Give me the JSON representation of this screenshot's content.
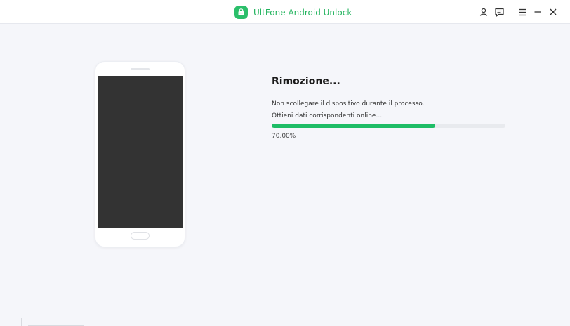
{
  "titlebar": {
    "app_name": "UltFone Android Unlock",
    "brand_color": "#21b35d",
    "icons": [
      "user-icon",
      "feedback-icon",
      "menu-icon",
      "minimize-icon",
      "close-icon"
    ]
  },
  "device": {
    "screen_color": "#333333"
  },
  "status": {
    "title": "Rimozione...",
    "note": "Non scollegare il dispositivo durante il processo.",
    "step": "Ottieni dati corrispondenti online...",
    "progress_fraction": 0.7,
    "progress_label": "70.00%",
    "progress_color": "#1ebd66"
  }
}
